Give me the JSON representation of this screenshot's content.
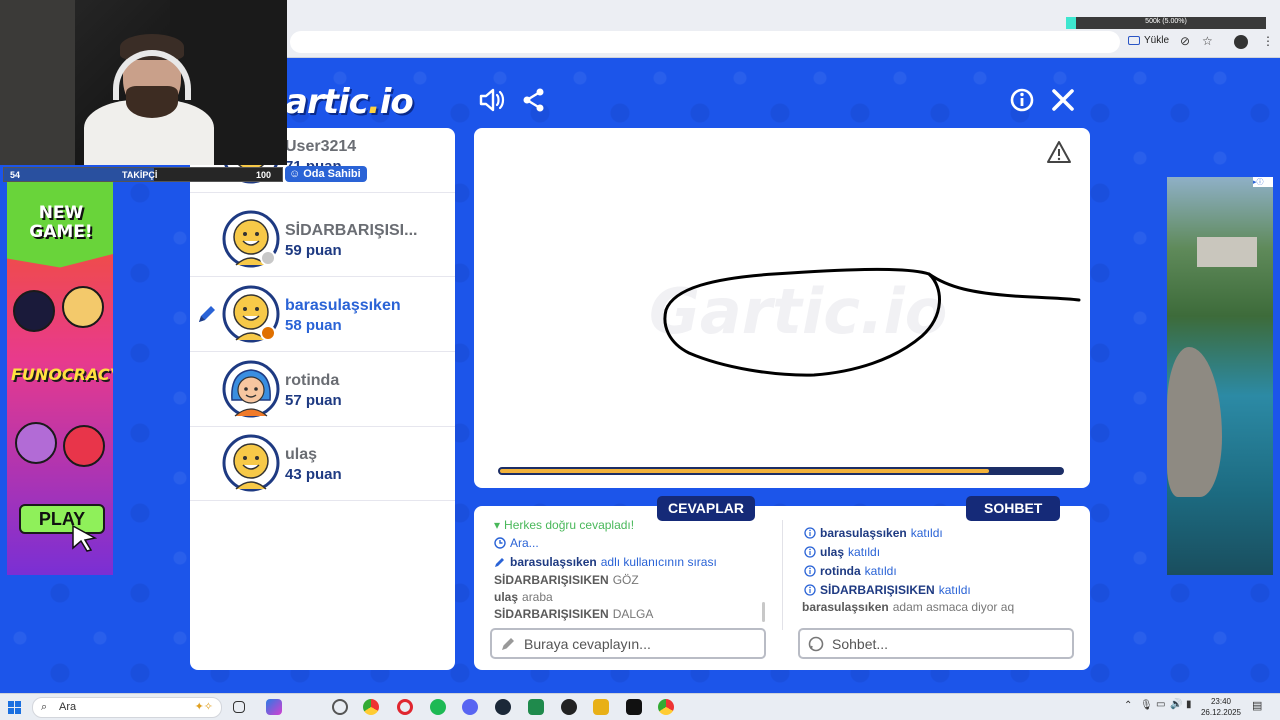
{
  "browser": {
    "upload_label": "Yükle",
    "obs_stat": "500k (5.00%)",
    "obs_fill_fraction": 0.05
  },
  "stream": {
    "follower_count": "54",
    "follower_label": "TAKİPÇİ",
    "follower_goal": "100",
    "follower_fraction": 0.54
  },
  "game": {
    "logo_main": "artic",
    "logo_dot": ".",
    "logo_end": "io",
    "players": [
      {
        "name": "User3214",
        "points": "71 puan",
        "owner_badge": "Oda Sahibi",
        "avatar": "yellow-smiley",
        "status_color": "#f2b23a"
      },
      {
        "name": "SİDARBARIŞISI...",
        "points": "59 puan",
        "avatar": "yellow-smiley",
        "status_color": "#c8c8c8"
      },
      {
        "name": "barasulaşsıken",
        "points": "58 puan",
        "avatar": "yellow-smiley",
        "status_color": "#e07000",
        "drawing": true
      },
      {
        "name": "rotinda",
        "points": "57 puan",
        "avatar": "blue-hair-girl"
      },
      {
        "name": "ulaş",
        "points": "43 puan",
        "avatar": "yellow-smiley"
      }
    ],
    "timer_fraction": 0.87,
    "answers_label": "CEVAPLAR",
    "chat_label": "SOHBET",
    "answers": [
      {
        "type": "green",
        "icon": "check-icon",
        "text": "Herkes doğru cevapladı!"
      },
      {
        "type": "blue",
        "icon": "clock-icon",
        "text": "Ara..."
      },
      {
        "type": "turn",
        "icon": "pencil-icon",
        "user": "barasulaşsıken",
        "text": "adlı kullanıcının sırası"
      },
      {
        "type": "guess",
        "user": "SİDARBARIŞISIKEN",
        "text": "GÖZ"
      },
      {
        "type": "guess",
        "user": "ulaş",
        "text": "araba"
      },
      {
        "type": "guess",
        "user": "SİDARBARIŞISIKEN",
        "text": "DALGA"
      }
    ],
    "chat": [
      {
        "user": "barasulaşsıken",
        "text": "katıldı"
      },
      {
        "user": "ulaş",
        "text": "katıldı"
      },
      {
        "user": "rotinda",
        "text": "katıldı"
      },
      {
        "user": "SİDARBARIŞISIKEN",
        "text": "katıldı"
      },
      {
        "user": "barasulaşsıken",
        "text": "adam asmaca diyor aq",
        "plain": true
      }
    ],
    "answer_placeholder": "Buraya cevaplayın...",
    "chat_placeholder": "Sohbet..."
  },
  "ad_left": {
    "headline": "NEW GAME!",
    "brand": "FUNOCRACY",
    "cta": "PLAY"
  },
  "taskbar": {
    "search_placeholder": "Ara",
    "time": "23:40",
    "date": "26.12.2025"
  }
}
